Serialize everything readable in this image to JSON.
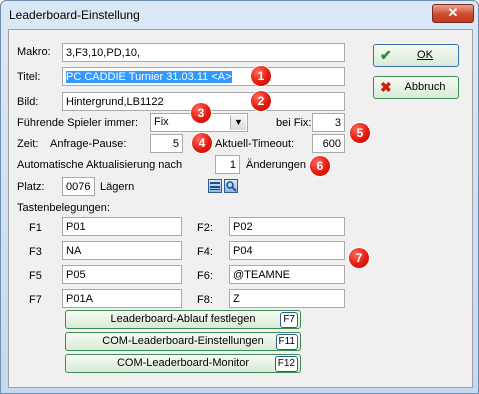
{
  "window": {
    "title": "Leaderboard-Einstellung",
    "close_label": "✕"
  },
  "makro": {
    "label": "Makro:",
    "value": "3,F3,10,PD,10,"
  },
  "titel": {
    "label": "Titel:",
    "value": "PC CADDIE Turnier 31.03.11 <A>"
  },
  "bild": {
    "label": "Bild:",
    "value": "Hintergrund,LB1122"
  },
  "fuehrende": {
    "label": "Führende Spieler immer:",
    "selected": "Fix",
    "bei_fix_label": "bei Fix:",
    "bei_fix_value": "3"
  },
  "zeit": {
    "label": "Zeit:",
    "anfrage_label": "Anfrage-Pause:",
    "anfrage_value": "5",
    "timeout_label": "Aktuell-Timeout:",
    "timeout_value": "600"
  },
  "auto": {
    "label": "Automatische Aktualisierung nach",
    "value": "1",
    "suffix": "Änderungen"
  },
  "platz": {
    "label": "Platz:",
    "value": "0076",
    "name": "Lägern"
  },
  "tasten": {
    "label": "Tastenbelegungen:",
    "keys": [
      {
        "label": "F1",
        "value": "P01"
      },
      {
        "label": "F2:",
        "value": "P02"
      },
      {
        "label": "F3",
        "value": "NA"
      },
      {
        "label": "F4:",
        "value": "P04"
      },
      {
        "label": "F5",
        "value": "P05"
      },
      {
        "label": "F6:",
        "value": "@TEAMNE"
      },
      {
        "label": "F7",
        "value": "P01A"
      },
      {
        "label": "F8:",
        "value": "Z"
      }
    ]
  },
  "buttons": {
    "ok": "OK",
    "abbruch": "Abbruch",
    "ablauf": {
      "label": "Leaderboard-Ablauf festlegen",
      "key": "F7"
    },
    "com_einst": {
      "label": "COM-Leaderboard-Einstellungen",
      "key": "F11"
    },
    "com_monitor": {
      "label": "COM-Leaderboard-Monitor",
      "key": "F12"
    }
  },
  "badges": [
    "1",
    "2",
    "3",
    "4",
    "5",
    "6",
    "7"
  ],
  "colors": {
    "selection": "#3399ff",
    "badge": "#e31b10",
    "button_border": "#3d8c55"
  }
}
